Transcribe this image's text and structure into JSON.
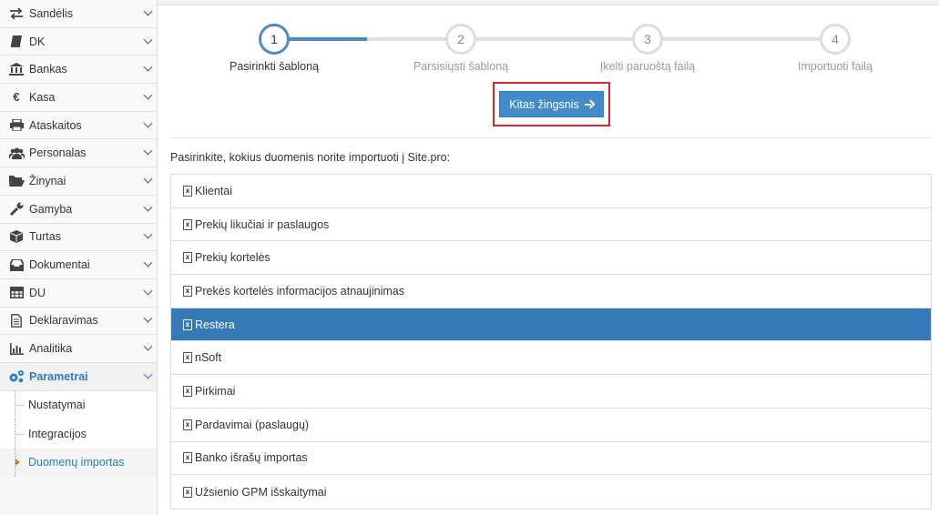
{
  "sidebar": {
    "items": [
      {
        "label": "Sandėlis",
        "icon": "arrows-exchange-icon"
      },
      {
        "label": "DK",
        "icon": "book-icon"
      },
      {
        "label": "Bankas",
        "icon": "bank-icon"
      },
      {
        "label": "Kasa",
        "icon": "euro-icon"
      },
      {
        "label": "Ataskaitos",
        "icon": "print-icon"
      },
      {
        "label": "Personalas",
        "icon": "users-icon"
      },
      {
        "label": "Žinynai",
        "icon": "folder-open-icon"
      },
      {
        "label": "Gamyba",
        "icon": "wrench-icon"
      },
      {
        "label": "Turtas",
        "icon": "cube-icon"
      },
      {
        "label": "Dokumentai",
        "icon": "inbox-icon"
      },
      {
        "label": "DU",
        "icon": "table-icon"
      },
      {
        "label": "Deklaravimas",
        "icon": "document-icon"
      },
      {
        "label": "Analitika",
        "icon": "bar-chart-icon"
      },
      {
        "label": "Parametrai",
        "icon": "gears-icon"
      }
    ],
    "subitems": [
      {
        "label": "Nustatymai"
      },
      {
        "label": "Integracijos"
      },
      {
        "label": "Duomenų importas"
      }
    ]
  },
  "wizard": {
    "steps": [
      {
        "number": "1",
        "label": "Pasirinkti šabloną"
      },
      {
        "number": "2",
        "label": "Parsisiųsti šabloną"
      },
      {
        "number": "3",
        "label": "Įkelti paruoštą failą"
      },
      {
        "number": "4",
        "label": "Importuoti failą"
      }
    ],
    "active_step": 1,
    "next_button": "Kitas žingsnis"
  },
  "instruction": "Pasirinkite, kokius duomenis norite importuoti į Site.pro:",
  "templates": [
    "Klientai",
    "Prekių likučiai ir paslaugos",
    "Prekių kortelės",
    "Prekės kortelės informacijos atnaujinimas",
    "Restera",
    "nSoft",
    "Pirkimai",
    "Pardavimai (paslaugų)",
    "Banko išrašų importas",
    "Užsienio GPM išskaitymai"
  ],
  "selected_template": "Restera",
  "colors": {
    "accent": "#428bca",
    "selected_row": "#337ab7",
    "highlight_border": "#d9262c",
    "active_nav": "#2d7dc0"
  }
}
